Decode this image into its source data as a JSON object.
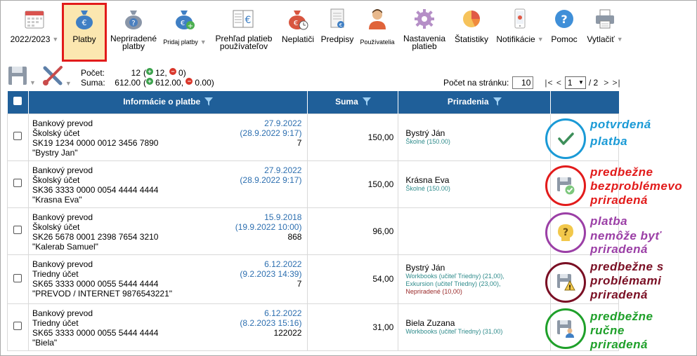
{
  "toolbar": {
    "items": [
      {
        "label": "2022/2023",
        "icon": "calendar-icon"
      },
      {
        "label": "Platby",
        "icon": "money-bag-euro-icon"
      },
      {
        "label": "Nepriradené platby",
        "icon": "money-bag-question-icon"
      },
      {
        "label": "Pridaj platby",
        "icon": "money-bag-add-icon"
      },
      {
        "label": "Prehľad platieb používateľov",
        "icon": "ledger-icon"
      },
      {
        "label": "Neplatiči",
        "icon": "money-bag-clock-icon"
      },
      {
        "label": "Predpisy",
        "icon": "document-euro-icon"
      },
      {
        "label": "Používatelia",
        "icon": "user-icon"
      },
      {
        "label": "Nastavenia platieb",
        "icon": "gear-icon"
      },
      {
        "label": "Štatistiky",
        "icon": "pie-chart-icon"
      },
      {
        "label": "Notifikácie",
        "icon": "phone-icon"
      },
      {
        "label": "Pomoc",
        "icon": "help-icon"
      },
      {
        "label": "Vytlačiť",
        "icon": "printer-icon"
      }
    ]
  },
  "counts": {
    "count_label": "Počet:",
    "count_total": "12",
    "count_plus": "12,",
    "count_minus": "0)",
    "sum_label": "Suma:",
    "sum_total": "612.00",
    "sum_plus": "612.00,",
    "sum_minus": "0.00)"
  },
  "pager": {
    "per_page_label": "Počet na stránku:",
    "per_page_value": "10",
    "nav_prev": "|< <",
    "page_value": "1",
    "of_pages": "/ 2",
    "nav_next": "> >|"
  },
  "table": {
    "headers": {
      "info": "Informácie o platbe",
      "sum": "Suma",
      "assign": "Priradenia"
    },
    "rows": [
      {
        "type": "Bankový prevod",
        "account": "Školský účet",
        "iban": "SK19 1234 0000 0012 3456 7890",
        "name": "\"Bystry Jan\"",
        "date": "27.9.2022",
        "date2": "(28.9.2022 9:17)",
        "ref": "7",
        "sum": "150,00",
        "assign_name": "Bystrý Ján",
        "assign_items": [
          {
            "text": "Školné (150.00)",
            "color": "teal"
          }
        ],
        "status_label": [
          "potvrdená",
          "platba"
        ],
        "status_color": "#1a9ad6",
        "status_icon": "check-icon"
      },
      {
        "type": "Bankový prevod",
        "account": "Školský účet",
        "iban": "SK36 3333 0000 0054 4444 4444",
        "name": "\"Krasna Eva\"",
        "date": "27.9.2022",
        "date2": "(28.9.2022 9:17)",
        "ref": "",
        "sum": "150,00",
        "assign_name": "Krásna Eva",
        "assign_items": [
          {
            "text": "Školné (150.00)",
            "color": "teal"
          }
        ],
        "status_label": [
          "predbežne",
          "bezproblémevo",
          "priradená"
        ],
        "status_color": "#e21b1b",
        "status_icon": "save-check-icon"
      },
      {
        "type": "Bankový prevod",
        "account": "Školský účet",
        "iban": "SK26 5678 0001 2398 7654 3210",
        "name": "\"Kalerab Samuel\"",
        "date": "15.9.2018",
        "date2": "(19.9.2022 10:00)",
        "ref": "868",
        "sum": "96,00",
        "assign_name": "",
        "assign_items": [],
        "status_label": [
          "platba",
          "nemôže byť",
          "priradená"
        ],
        "status_color": "#9b3fa6",
        "status_icon": "question-head-icon"
      },
      {
        "type": "Bankový prevod",
        "account": "Triedny účet",
        "iban": "SK65 3333 0000 0055 5444 4444",
        "name": "\"PREVOD / INTERNET 9876543221\"",
        "date": "6.12.2022",
        "date2": "(9.2.2023 14:39)",
        "ref": "7",
        "sum": "54,00",
        "assign_name": "Bystrý Ján",
        "assign_items": [
          {
            "text": "Workbooks (učiteľ Triedny) (21,00),",
            "color": "teal"
          },
          {
            "text": "Exkursion (učiteľ Triedny) (23,00),",
            "color": "teal"
          },
          {
            "text": "Nepriradené (10,00)",
            "color": "dred"
          }
        ],
        "status_label": [
          "predbežne s",
          "problémami",
          "priradená"
        ],
        "status_color": "#7a0f24",
        "status_icon": "save-warning-icon"
      },
      {
        "type": "Bankový prevod",
        "account": "Triedny účet",
        "iban": "SK65 3333 0000 0055 5444 4444",
        "name": "\"Biela\"",
        "date": "6.12.2022",
        "date2": "(8.2.2023 15:16)",
        "ref": "122022",
        "sum": "31,00",
        "assign_name": "Biela Zuzana",
        "assign_items": [
          {
            "text": "Workbooks (učiteľ Triedny) (31,00)",
            "color": "teal"
          }
        ],
        "status_label": [
          "predbežne",
          "ručne",
          "priradená"
        ],
        "status_color": "#1fa02a",
        "status_icon": "save-user-icon"
      }
    ]
  }
}
